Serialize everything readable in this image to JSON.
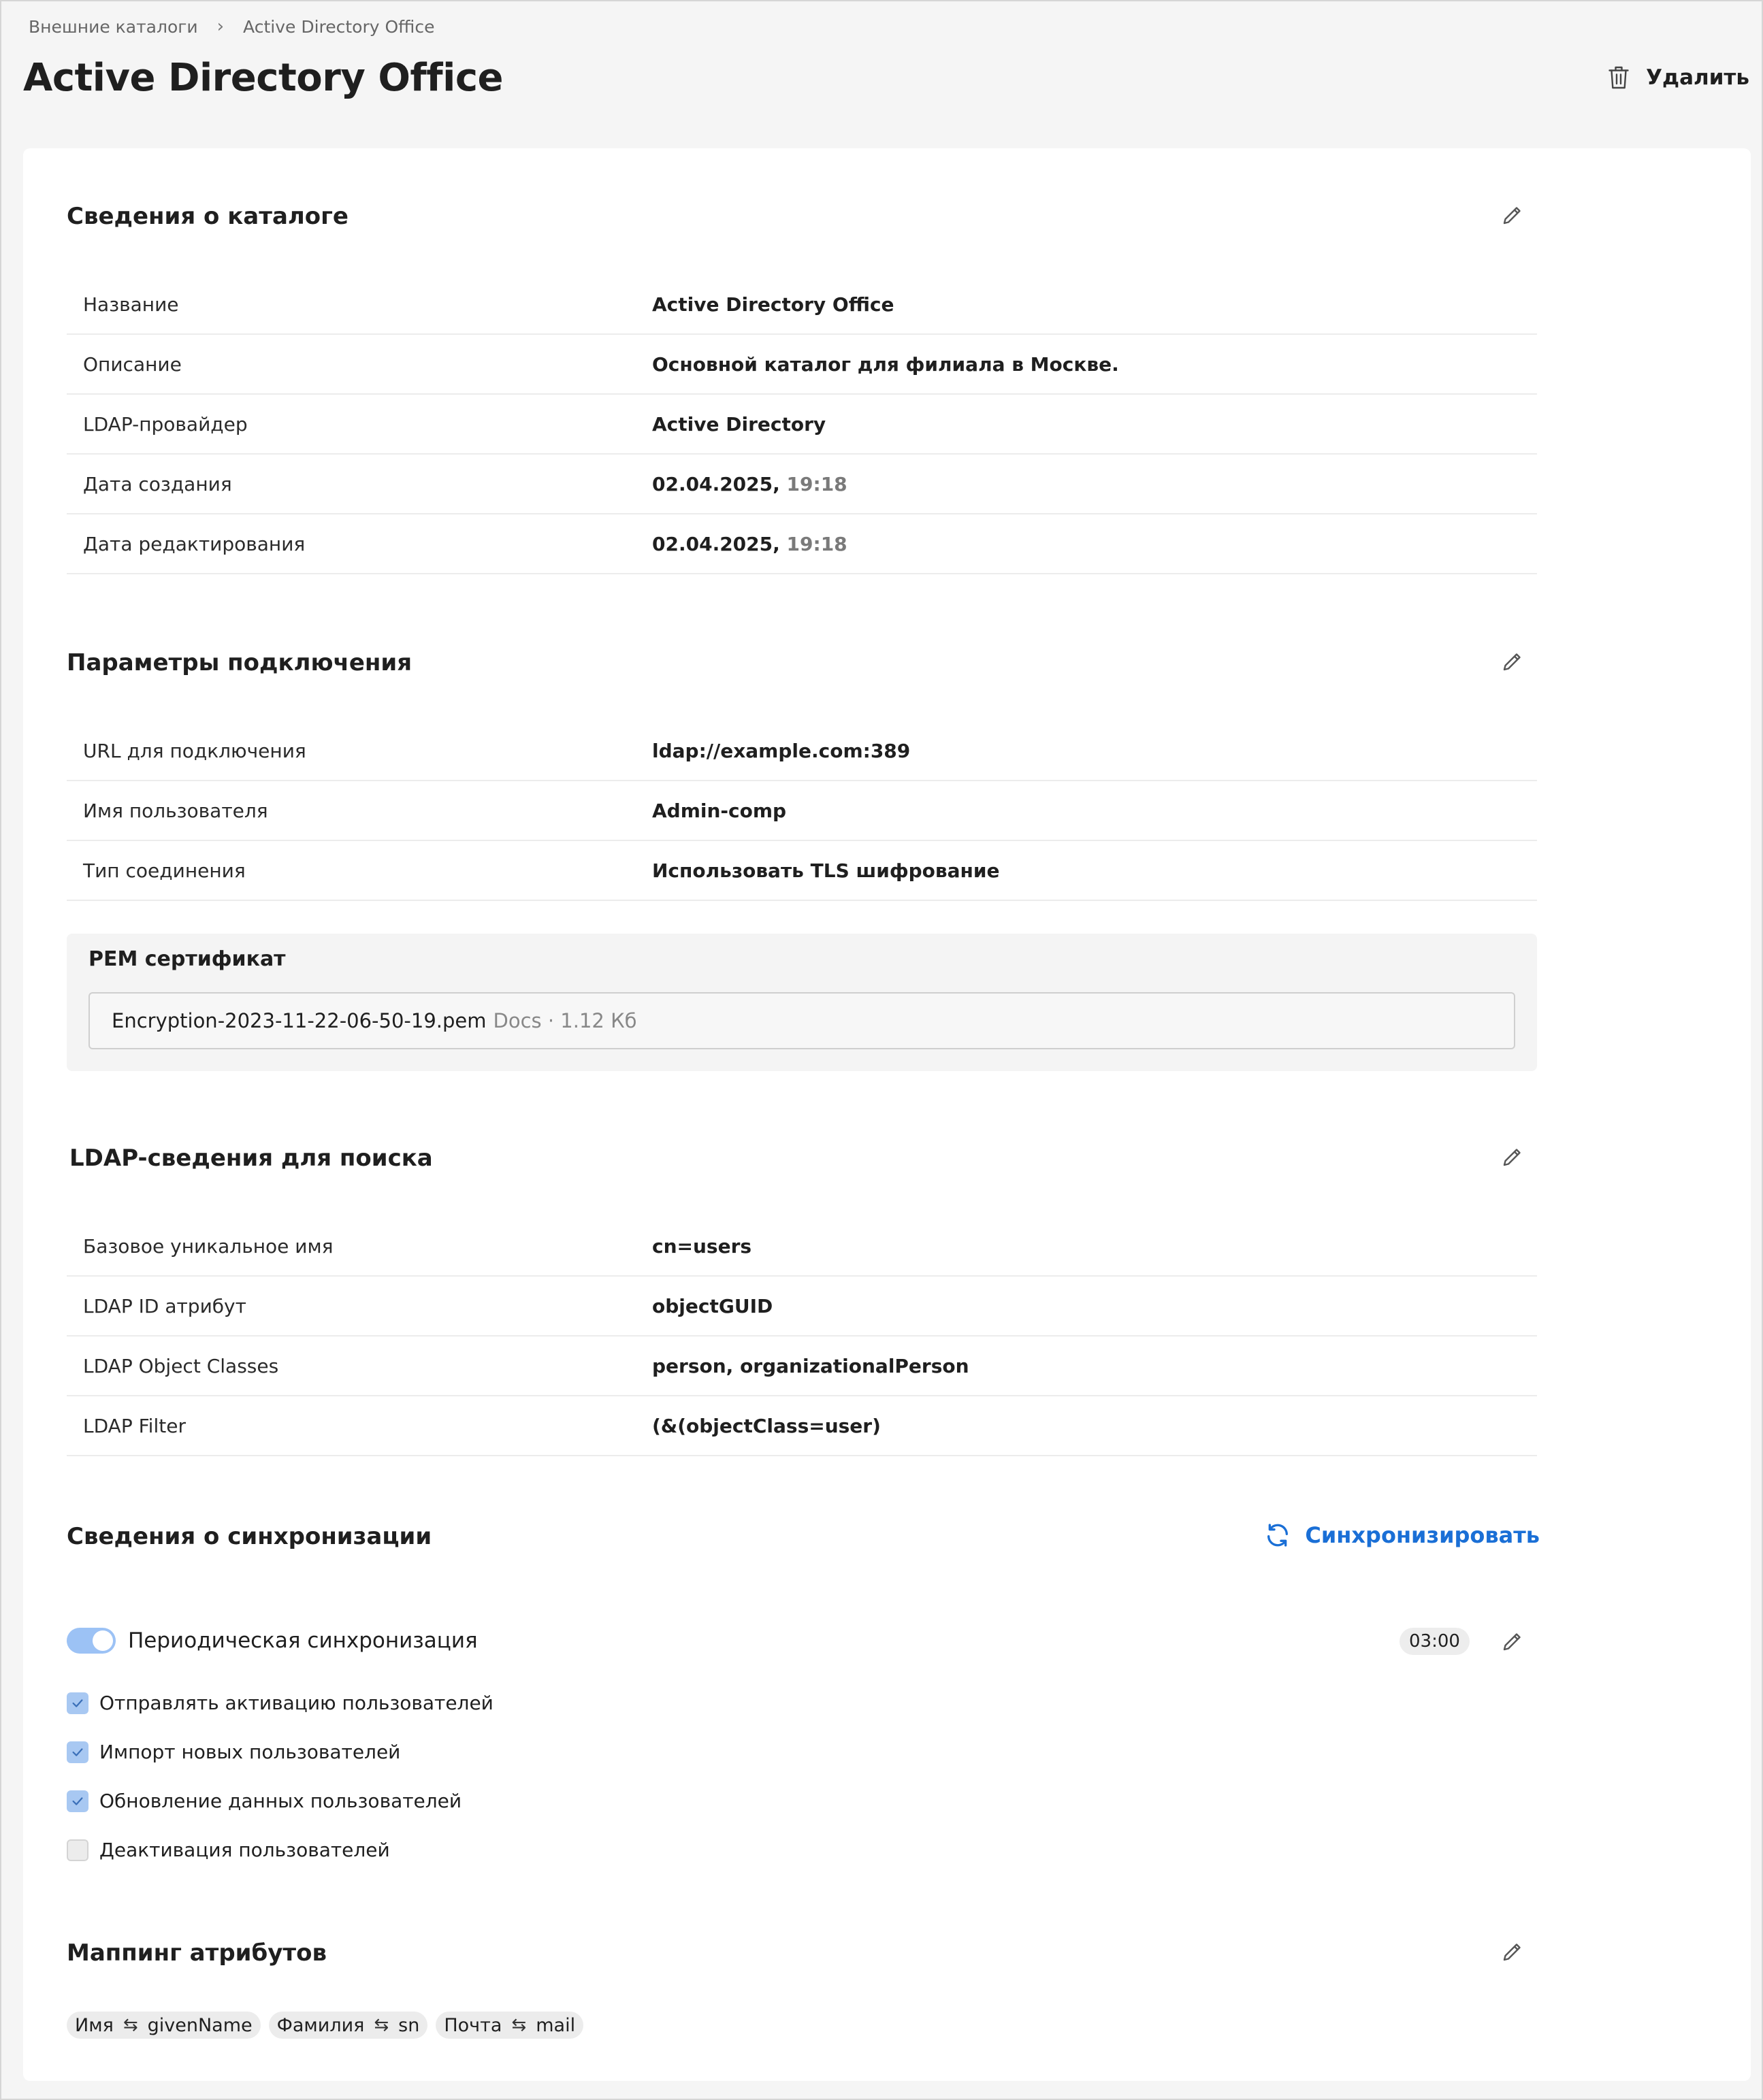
{
  "breadcrumb": {
    "parent": "Внешние каталоги",
    "separator": "›",
    "current": "Active Directory Office"
  },
  "page": {
    "title": "Active Directory Office",
    "delete_label": "Удалить"
  },
  "catalog_info": {
    "title": "Сведения о каталоге",
    "rows": [
      {
        "label": "Название",
        "value": "Active Directory Office"
      },
      {
        "label": "Описание",
        "value": "Основной каталог для филиала в Москве."
      },
      {
        "label": "LDAP-провайдер",
        "value": "Active Directory"
      },
      {
        "label": "Дата создания",
        "date": "02.04.2025,",
        "time": "19:18"
      },
      {
        "label": "Дата редактирования",
        "date": "02.04.2025,",
        "time": "19:18"
      }
    ]
  },
  "connection": {
    "title": "Параметры подключения",
    "rows": [
      {
        "label": "URL для подключения",
        "value": "ldap://example.com:389"
      },
      {
        "label": "Имя пользователя",
        "value": "Admin-comp"
      },
      {
        "label": "Тип соединения",
        "value": "Использовать TLS шифрование"
      }
    ],
    "pem": {
      "title": "PEM сертификат",
      "file_name": "Encryption-2023-11-22-06-50-19.pem",
      "file_meta": "Docs · 1.12 Кб"
    }
  },
  "ldap_search": {
    "title": "LDAP-сведения для поиска",
    "rows": [
      {
        "label": "Базовое уникальное имя",
        "value": "cn=users"
      },
      {
        "label": "LDAP ID атрибут",
        "value": "objectGUID"
      },
      {
        "label": "LDAP Object Classes",
        "value": "person, organizationalPerson"
      },
      {
        "label": "LDAP Filter",
        "value": "(&(objectClass=user)"
      }
    ]
  },
  "sync": {
    "title": "Сведения о синхронизации",
    "sync_button": "Синхронизировать",
    "periodic_label": "Периодическая синхронизация",
    "periodic_enabled": true,
    "time": "03:00",
    "options": [
      {
        "label": "Отправлять активацию пользователей",
        "checked": true
      },
      {
        "label": "Импорт новых пользователей",
        "checked": true
      },
      {
        "label": "Обновление данных пользователей",
        "checked": true
      },
      {
        "label": "Деактивация пользователей",
        "checked": false
      }
    ]
  },
  "mapping": {
    "title": "Маппинг атрибутов",
    "arrow": "⇆",
    "items": [
      {
        "from": "Имя",
        "to": "givenName"
      },
      {
        "from": "Фамилия",
        "to": "sn"
      },
      {
        "from": "Почта",
        "to": "mail"
      }
    ]
  },
  "colors": {
    "accent": "#1a6fd6",
    "toggle_on": "#9cc2f5",
    "checkbox_on": "#a8c8f2",
    "background": "#f5f5f5"
  },
  "icons": {
    "delete": "trash-icon",
    "edit": "pencil-icon",
    "sync": "refresh-icon",
    "check": "check-icon",
    "breadcrumb_sep": "chevron-right-icon"
  }
}
